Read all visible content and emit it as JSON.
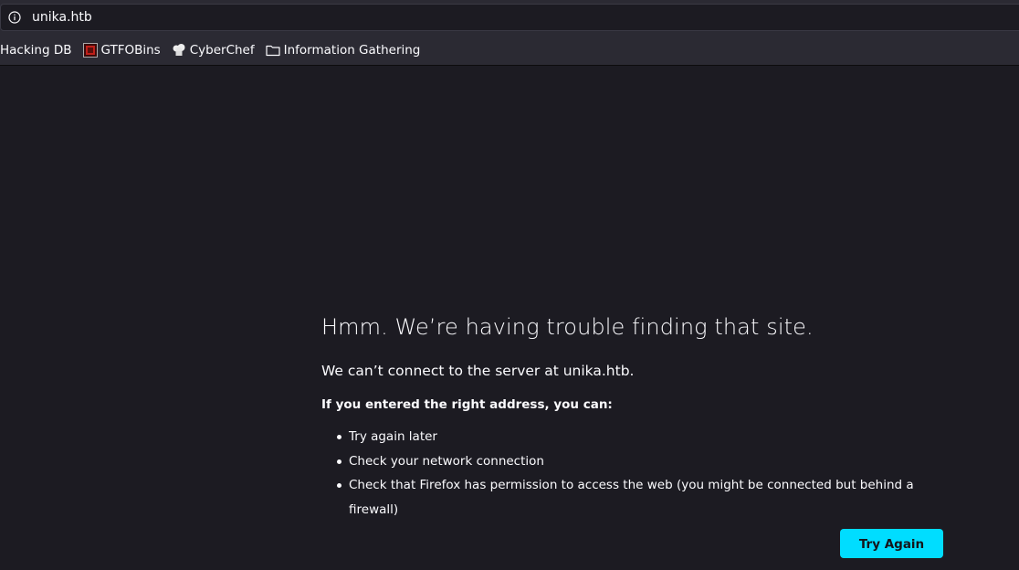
{
  "browser": {
    "url": "unika.htb",
    "bookmarks": [
      {
        "label": "Hacking DB",
        "icon": "none"
      },
      {
        "label": "GTFOBins",
        "icon": "gtfobins-icon"
      },
      {
        "label": "CyberChef",
        "icon": "cyberchef-icon"
      },
      {
        "label": "Information Gathering",
        "icon": "folder-icon"
      }
    ]
  },
  "error": {
    "title": "Hmm. We’re having trouble finding that site.",
    "description": "We can’t connect to the server at unika.htb.",
    "subheading": "If you entered the right address, you can:",
    "suggestions": [
      "Try again later",
      "Check your network connection",
      "Check that Firefox has permission to access the web (you might be connected but behind a firewall)"
    ],
    "button_label": "Try Again"
  },
  "colors": {
    "background": "#1c1b22",
    "toolbar": "#2b2a33",
    "accent": "#00ddff"
  }
}
